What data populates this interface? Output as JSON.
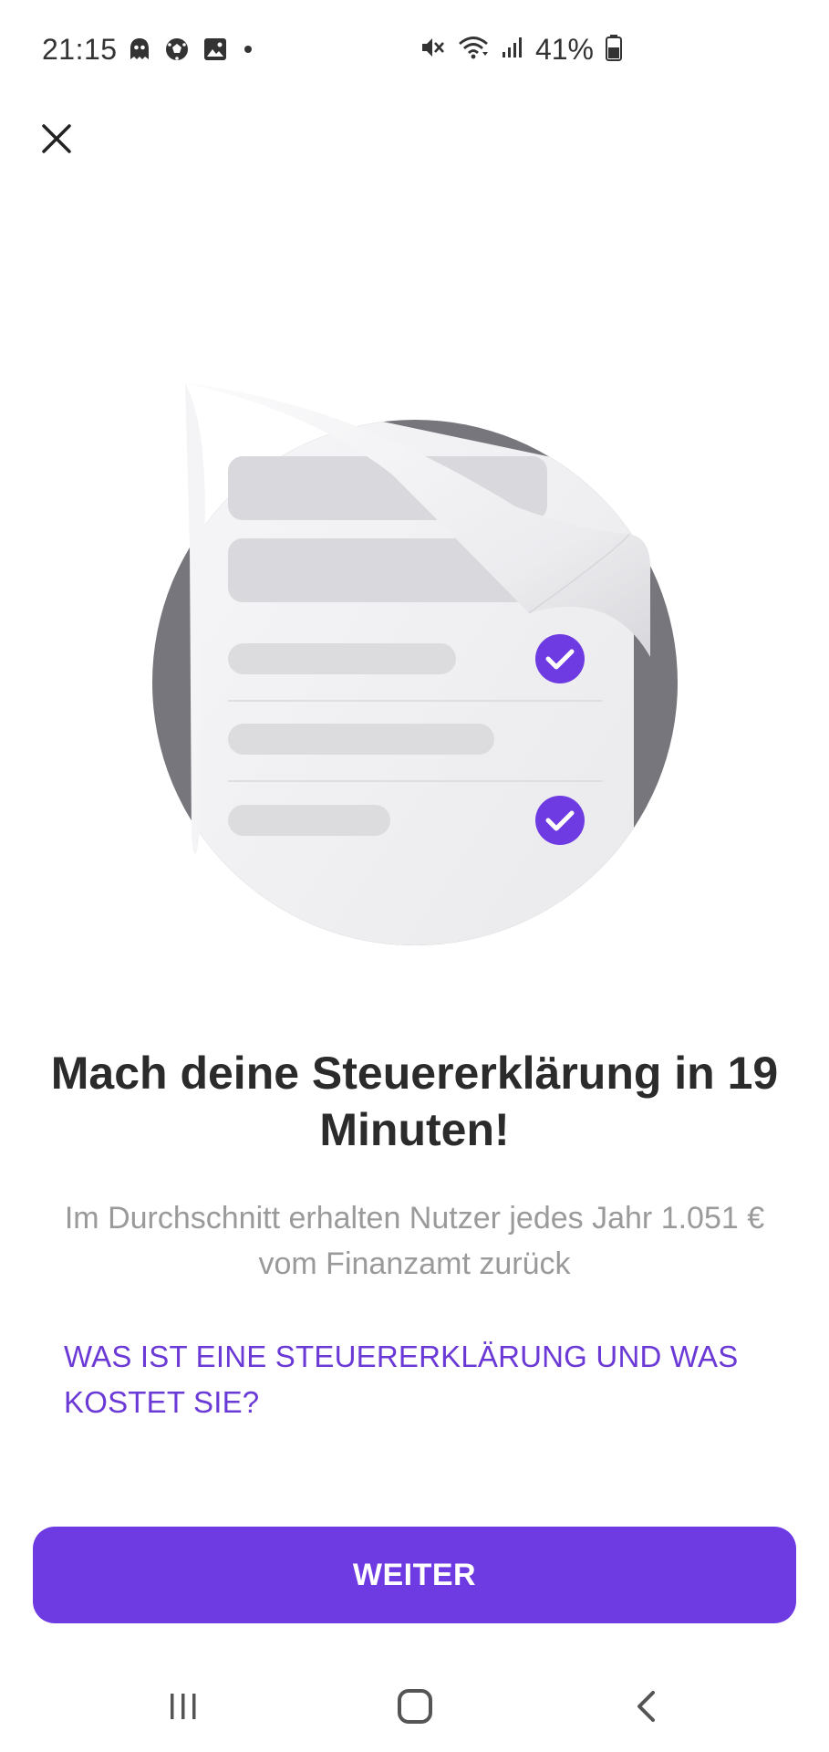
{
  "status_bar": {
    "time": "21:15",
    "notification_icons": [
      "ghost-icon",
      "soccer-ball-icon",
      "gallery-icon",
      "dot-icon"
    ],
    "system_icons": [
      "mute-icon",
      "wifi-icon",
      "signal-icon"
    ],
    "battery_percent": "41%"
  },
  "header": {
    "close_icon": "close-icon"
  },
  "illustration": {
    "accent_color": "#6e3ae2",
    "circle_color": "#77767c",
    "paper_color": "#f2f2f4",
    "checked_items": [
      "check-icon",
      "check-icon"
    ]
  },
  "content": {
    "headline": "Mach deine Steuererklärung in 19 Minuten!",
    "subtitle": "Im Durchschnitt erhalten Nutzer jedes Jahr 1.051 € vom Finanzamt zurück",
    "info_link": "WAS IST EINE STEUERERKLÄRUNG UND WAS KOSTET SIE?"
  },
  "actions": {
    "primary_label": "WEITER",
    "primary_color": "#6e3ae2"
  },
  "nav_bar": {
    "items": [
      "recent-apps-icon",
      "home-icon",
      "back-icon"
    ]
  }
}
